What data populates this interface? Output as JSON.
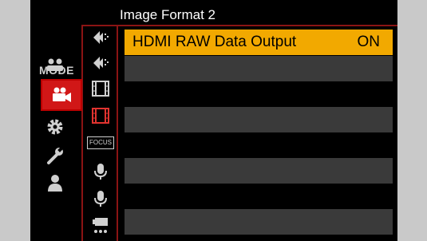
{
  "title": "Image Format 2",
  "mode_label": "MODE",
  "menu": {
    "items": [
      {
        "label": "HDMI RAW Data Output",
        "value": "ON"
      },
      {
        "label": "",
        "value": ""
      },
      {
        "label": "",
        "value": ""
      },
      {
        "label": "",
        "value": ""
      },
      {
        "label": "",
        "value": ""
      },
      {
        "label": "",
        "value": ""
      },
      {
        "label": "",
        "value": ""
      },
      {
        "label": "",
        "value": ""
      }
    ]
  },
  "focus_subtab_label": "FOCUS",
  "colors": {
    "accent_red": "#d11717",
    "selected_row": "#f2a900",
    "row_bg": "#3a3a3a",
    "frame_red": "#8b1414"
  }
}
